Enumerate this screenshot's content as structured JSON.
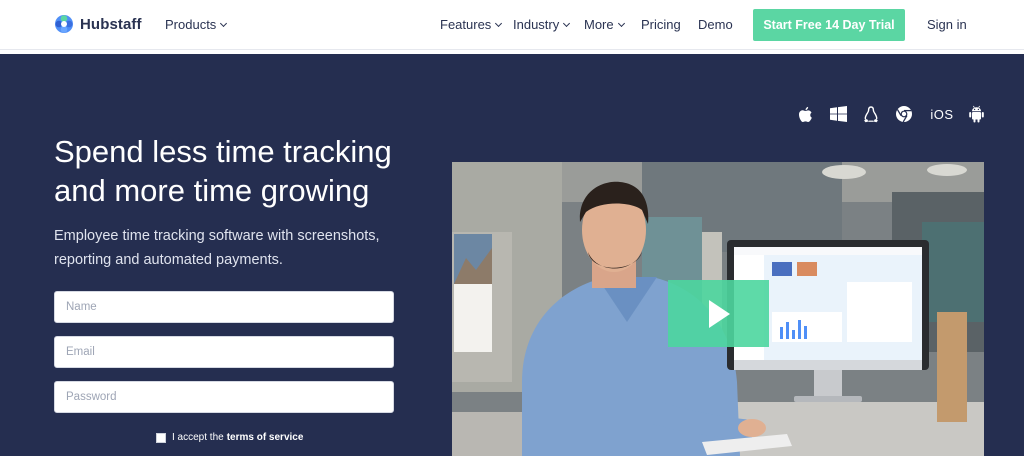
{
  "nav": {
    "brand": "Hubstaff",
    "products_label": "Products",
    "features_label": "Features",
    "industry_label": "Industry",
    "more_label": "More",
    "pricing_label": "Pricing",
    "demo_label": "Demo",
    "trial_label": "Start Free 14 Day Trial",
    "signin_label": "Sign in"
  },
  "hero": {
    "headline": "Spend less time tracking and more time growing",
    "subtext": "Employee time tracking software with screenshots, reporting and automated payments.",
    "platforms": [
      "apple-icon",
      "windows-icon",
      "linux-icon",
      "chrome-icon",
      "iOS",
      "android-icon"
    ],
    "ios_label": "iOS"
  },
  "form": {
    "name_placeholder": "Name",
    "email_placeholder": "Email",
    "password_placeholder": "Password",
    "terms_prefix": "I accept the",
    "terms_link": "terms of service"
  },
  "video": {
    "play_icon": "play-icon"
  },
  "colors": {
    "hero_bg": "#252e50",
    "accent": "#5bd6a3",
    "nav_text": "#2a3352"
  }
}
